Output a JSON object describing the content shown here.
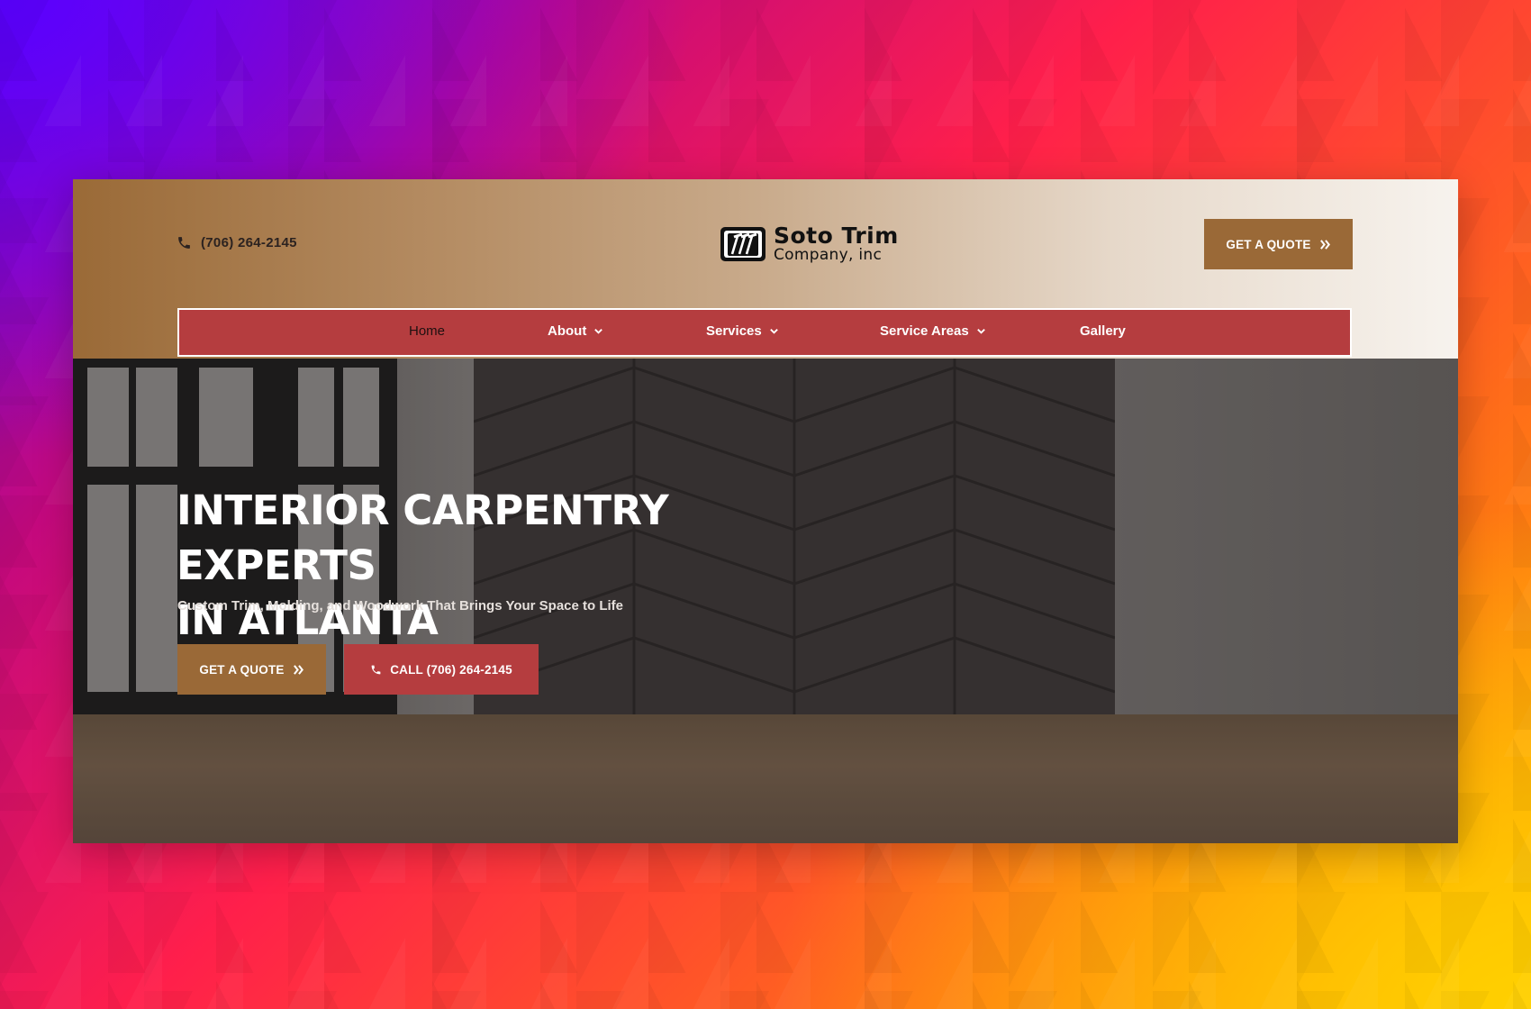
{
  "header": {
    "phone": "(706) 264-2145",
    "logo": {
      "name": "Soto Trim",
      "sub": "Company, inc"
    },
    "quote_label": "GET A QUOTE"
  },
  "nav": {
    "items": [
      {
        "label": "Home",
        "active": true,
        "dropdown": false
      },
      {
        "label": "About",
        "active": false,
        "dropdown": true
      },
      {
        "label": "Services",
        "active": false,
        "dropdown": true
      },
      {
        "label": "Service Areas",
        "active": false,
        "dropdown": true
      },
      {
        "label": "Gallery",
        "active": false,
        "dropdown": false
      }
    ]
  },
  "hero": {
    "title_line1": "INTERIOR CARPENTRY EXPERTS",
    "title_line2": "IN ATLANTA",
    "subtitle": "Custom Trim, Molding, and Woodwork That Brings Your Space to Life",
    "quote_label": "GET A QUOTE",
    "call_label": "CALL (706) 264-2145"
  },
  "icons": {
    "phone": "phone-icon",
    "double_chevron": "double-chevron-right-icon",
    "chevron_down": "chevron-down-icon",
    "logo_mark": "hammers-logo-icon"
  },
  "colors": {
    "brand_brown": "#9a6937",
    "brand_red": "#b53d3f",
    "text_dark": "#2b2220",
    "white": "#ffffff"
  }
}
